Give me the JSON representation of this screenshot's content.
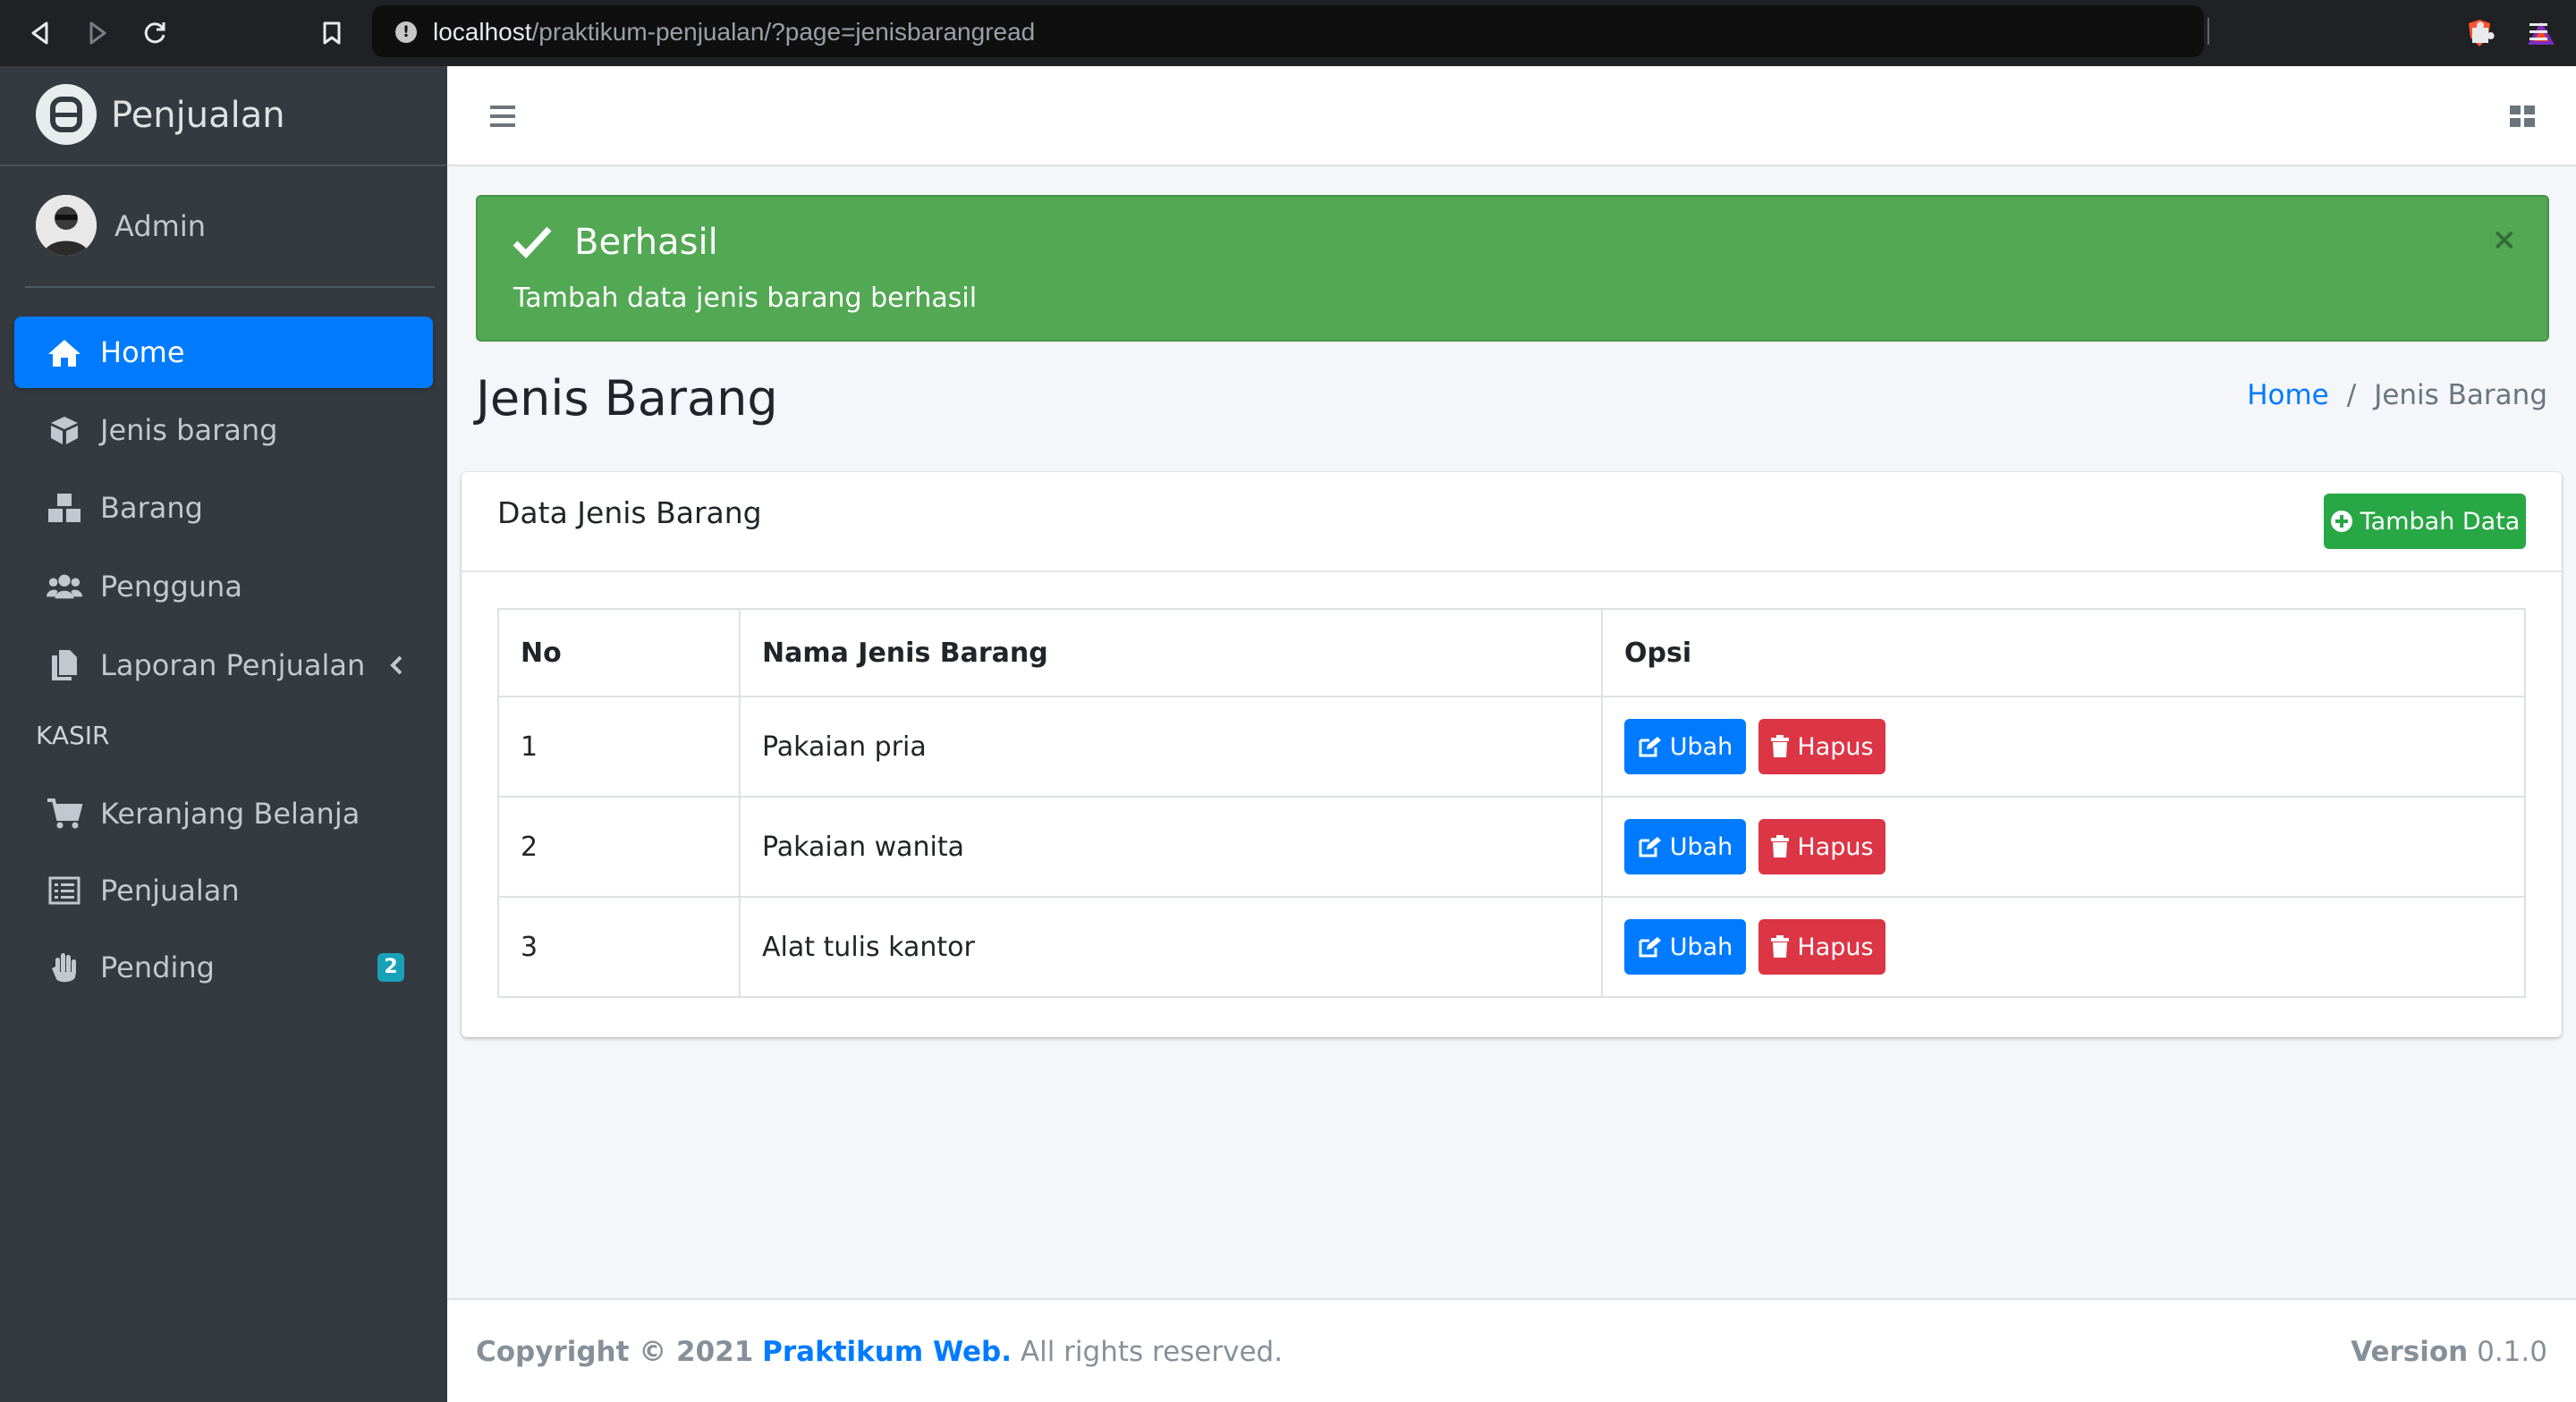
{
  "browser": {
    "url_host": "localhost",
    "url_path": "/praktikum-penjualan/?page=jenisbarangread",
    "info_icon": "info-icon",
    "icons": [
      "back-icon",
      "forward-icon",
      "reload-icon",
      "bookmark-icon",
      "brave-shield-icon",
      "brave-rewards-icon",
      "extensions-icon",
      "browser-menu-icon"
    ]
  },
  "sidebar": {
    "brand": "Penjualan",
    "user": "Admin",
    "items": [
      {
        "label": "Home",
        "icon": "home-icon",
        "active": true
      },
      {
        "label": "Jenis barang",
        "icon": "box-icon"
      },
      {
        "label": "Barang",
        "icon": "boxes-icon"
      },
      {
        "label": "Pengguna",
        "icon": "users-icon"
      },
      {
        "label": "Laporan Penjualan",
        "icon": "copy-icon",
        "has_submenu": true
      }
    ],
    "header": "KASIR",
    "kasir_items": [
      {
        "label": "Keranjang Belanja",
        "icon": "cart-icon"
      },
      {
        "label": "Penjualan",
        "icon": "list-icon"
      },
      {
        "label": "Pending",
        "icon": "hand-icon",
        "badge": "2"
      }
    ]
  },
  "alert": {
    "title": "Berhasil",
    "message": "Tambah data jenis barang berhasil",
    "close": "×",
    "color": "#52a853"
  },
  "page": {
    "title": "Jenis Barang",
    "breadcrumb": {
      "home": "Home",
      "separator": "/",
      "current": "Jenis Barang"
    }
  },
  "card": {
    "title": "Data Jenis Barang",
    "add_button": "Tambah Data",
    "columns": [
      "No",
      "Nama Jenis Barang",
      "Opsi"
    ],
    "rows": [
      {
        "no": "1",
        "name": "Pakaian pria"
      },
      {
        "no": "2",
        "name": "Pakaian wanita"
      },
      {
        "no": "3",
        "name": "Alat tulis kantor"
      }
    ],
    "edit_label": "Ubah",
    "delete_label": "Hapus"
  },
  "footer": {
    "copyright": "Copyright © 2021",
    "brand": "Praktikum Web.",
    "rights": "All rights reserved.",
    "version_label": "Version",
    "version": "0.1.0"
  },
  "colors": {
    "primary": "#007bff",
    "success": "#28a745",
    "danger": "#dc3545",
    "sidebar": "#343a40",
    "badge": "#17a2b8"
  }
}
